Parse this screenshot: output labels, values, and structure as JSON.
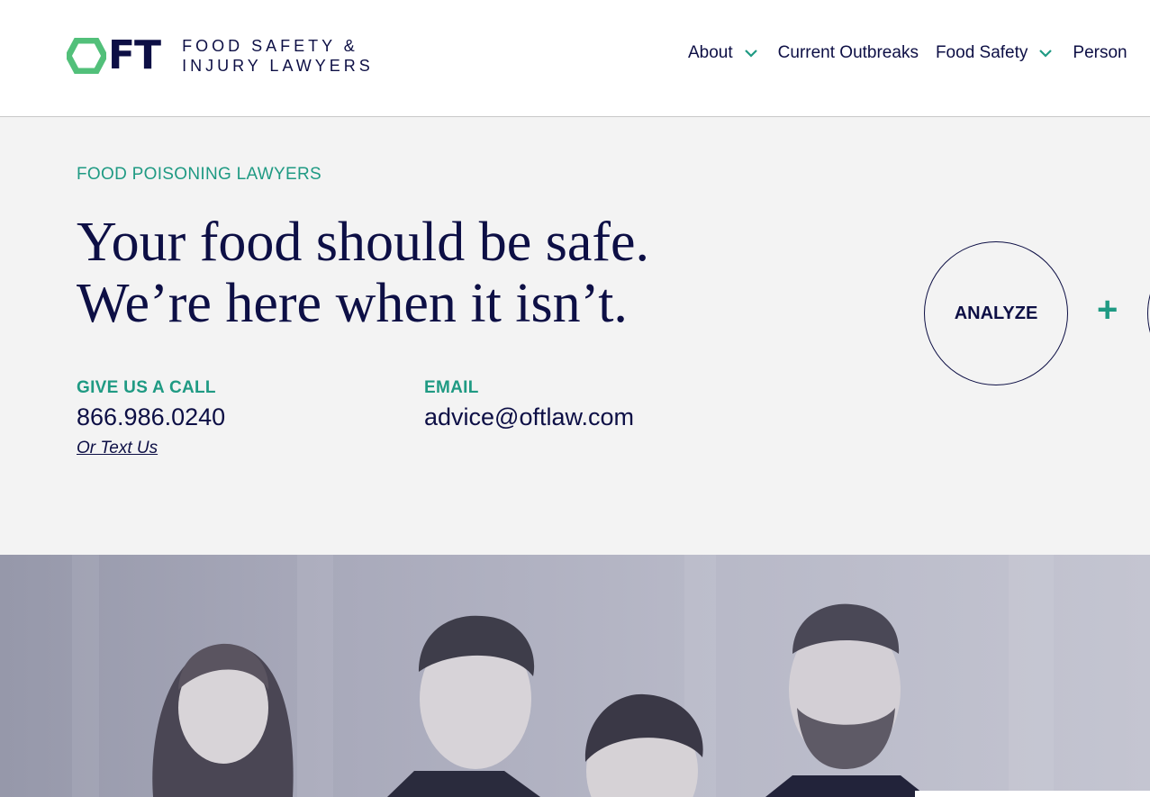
{
  "brand": {
    "logo_letters": "FT",
    "logo_line1": "FOOD SAFETY &",
    "logo_line2": "INJURY LAWYERS",
    "primary_color": "#0d0f45",
    "accent_color": "#1f9a83",
    "logo_hex_color": "#52c07a"
  },
  "nav": {
    "about": "About",
    "current_outbreaks": "Current Outbreaks",
    "food_safety": "Food Safety",
    "personal": "Person"
  },
  "hero": {
    "eyebrow": "FOOD POISONING LAWYERS",
    "headline_line1": "Your food should be safe.",
    "headline_line2": "We’re here when it isn’t.",
    "call_label": "GIVE US A CALL",
    "phone": "866.986.0240",
    "text_link": "Or Text Us",
    "email_label": "EMAIL",
    "email": "advice@oftlaw.com",
    "analyze_button": "ANALYZE",
    "plus_symbol": "+"
  },
  "photo": {
    "icon": "team-photo"
  }
}
